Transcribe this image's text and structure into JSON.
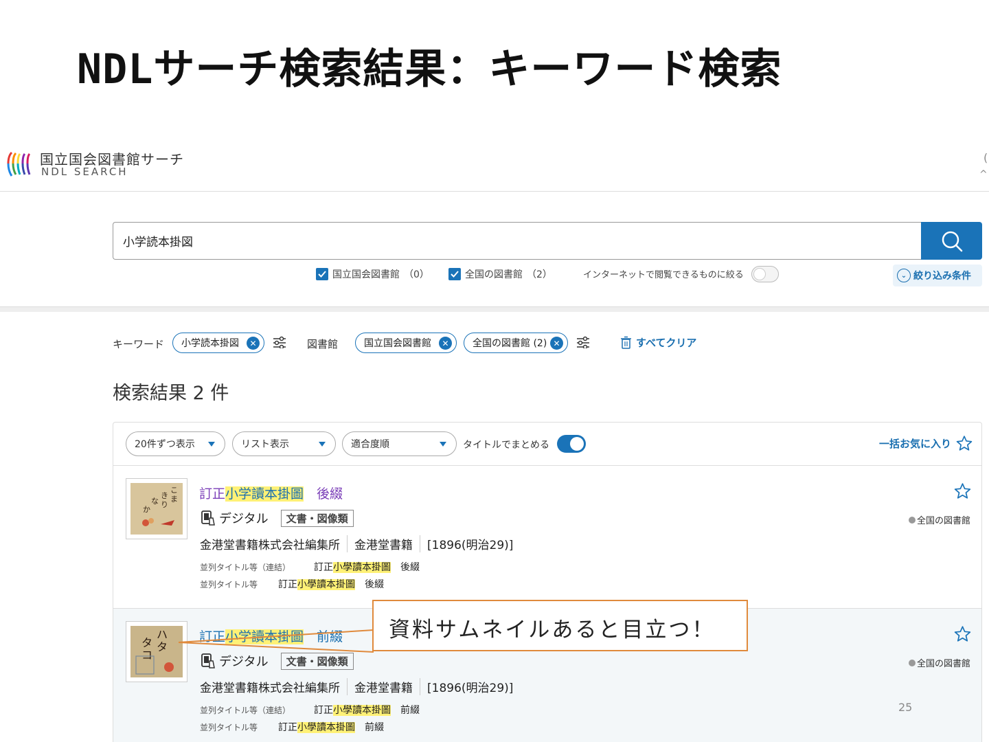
{
  "slide": {
    "title": "NDLサーチ検索結果：キーワード検索",
    "page_number": "25"
  },
  "header": {
    "logo_jp": "国立国会図書館サーチ",
    "logo_en": "NDL SEARCH"
  },
  "search": {
    "query": "小学読本掛図",
    "options": [
      {
        "label": "国立国会図書館",
        "count": "（0）",
        "checked": true
      },
      {
        "label": "全国の図書館",
        "count": "（2）",
        "checked": true
      }
    ],
    "internet_toggle_label": "インターネットで閲覧できるものに絞る",
    "filter_button": "絞り込み条件"
  },
  "facets": {
    "keyword_label": "キーワード",
    "keyword_chip": "小学読本掛図",
    "library_label": "図書館",
    "library_chips": [
      "国立国会図書館",
      "全国の図書館 (2)"
    ],
    "clear_all": "すべてクリア"
  },
  "results": {
    "count_text": "検索結果 2 件",
    "toolbar": {
      "per_page": "20件ずつ表示",
      "view": "リスト表示",
      "sort": "適合度順",
      "group_by_title": "タイトルでまとめる",
      "bulk_favorite": "一括お気に入り"
    },
    "items": [
      {
        "title_pre": "訂正",
        "title_hl": "小学讀本掛圖",
        "title_post": "　後綴",
        "media": "デジタル",
        "type": "文書・図像類",
        "meta": [
          "金港堂書籍株式会社編集所",
          "金港堂書籍",
          "[1896(明治29)]"
        ],
        "alt1_label": "並列タイトル等（連結）",
        "alt1_pre": "訂正",
        "alt1_hl": "小學讀本掛圖",
        "alt1_post": "　後綴",
        "alt2_label": "並列タイトル等",
        "alt2_pre": "訂正",
        "alt2_hl": "小學讀本掛圖",
        "alt2_post": "　後綴",
        "holding": "全国の図書館"
      },
      {
        "title_pre": "訂正",
        "title_hl": "小学讀本掛圖",
        "title_post": "　前綴",
        "media": "デジタル",
        "type": "文書・図像類",
        "meta": [
          "金港堂書籍株式会社編集所",
          "金港堂書籍",
          "[1896(明治29)]"
        ],
        "alt1_label": "並列タイトル等（連結）",
        "alt1_pre": "訂正",
        "alt1_hl": "小學讀本掛圖",
        "alt1_post": "　前綴",
        "alt2_label": "並列タイトル等",
        "alt2_pre": "訂正",
        "alt2_hl": "小學讀本掛圖",
        "alt2_post": "　前綴",
        "holding": "全国の図書館"
      }
    ]
  },
  "callout": {
    "text": "資料サムネイルあると目立つ！"
  },
  "colors": {
    "accent": "#1a73b8",
    "highlight": "#fff176",
    "title_visited": "#7b3fb8",
    "callout_border": "#e08a3c"
  }
}
